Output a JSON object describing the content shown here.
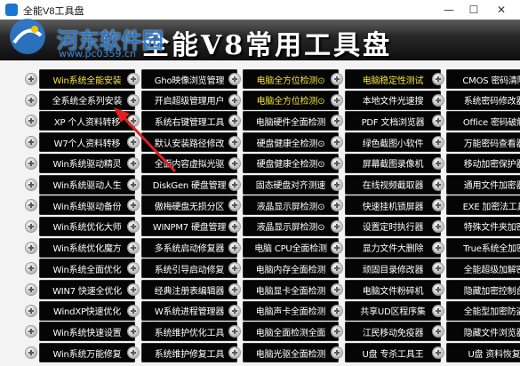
{
  "window": {
    "title": "全能V8工具盘",
    "min": "—",
    "max": "☐",
    "close": "✕"
  },
  "header": {
    "title": "全能V8常用工具盘"
  },
  "watermark": {
    "brand": "河东软件园",
    "url": "www.pc0359.cn"
  },
  "columns": [
    [
      "Win系统全能安装",
      "全系统全系列安装",
      "XP 个人资料转移",
      "W7个人资料转移",
      "Win系统驱动精灵",
      "Win系统驱动人生",
      "Win系统驱动备份",
      "Win系统优化大师",
      "Win系统优化魔方",
      "Win系统全面优化",
      "WIN7 快速全优化",
      "WindXP快速优化",
      "Win系统快速设置",
      "Win系统万能修复"
    ],
    [
      "Gho映像浏览管理",
      "开启超级管理用户",
      "系统右键管理工具",
      "默认安装路径修改",
      "全面内容虚拟光驱",
      "DiskGen 硬盘管理",
      "傲梅硬盘无损分区",
      "WINPM7 硬盘管理",
      "多系统启动修复器",
      "系统引导启动修复",
      "经典注册表编辑器",
      "W系统进程管理器",
      "系统维护优化工具",
      "系统维护修复工具"
    ],
    [
      "电脑全方位检测⊙",
      "电脑全方位检测⊙",
      "电脑硬件全面检测",
      "硬盘健康全检测⊙",
      "硬盘健康全检测⊙",
      "固态硬盘对齐测速",
      "液晶显示屏检测⊙",
      "液晶显示屏检测⊙",
      "电脑 CPU全面检测",
      "电脑内存全面检测",
      "电脑显卡全面检测",
      "电脑声卡全面检测",
      "电脑全面检测全面",
      "电脑光驱全面检测"
    ],
    [
      "电脑稳定性测试",
      "本地文件光速搜",
      "PDF 文档浏览器",
      "绿色截图小软件",
      "屏幕截图录像机",
      "在线视频截取器",
      "快速挂机锁屏器",
      "设置定时执行器",
      "显力文件大删除",
      "顽固目录修改器",
      "电脑文件粉碎机",
      "共享UD区程序集",
      "江民移动免疫器",
      "U盘 专杀工具王"
    ],
    [
      "CMOS 密码清除",
      "系统密码修改器",
      "Office 密码破解",
      "万能密码查看器",
      "移动加密保护器",
      "通用文件加密器",
      "EXE 加密法工具",
      "特殊文件夹加密",
      "True系统全加密",
      "全能超级加解密",
      "隐藏加密控制台",
      "全能型加密防盗",
      "隐藏文件浏览器",
      "U盘 资料恢复"
    ]
  ],
  "highlighted": [
    "0-0",
    "2-0",
    "2-1",
    "3-0"
  ]
}
